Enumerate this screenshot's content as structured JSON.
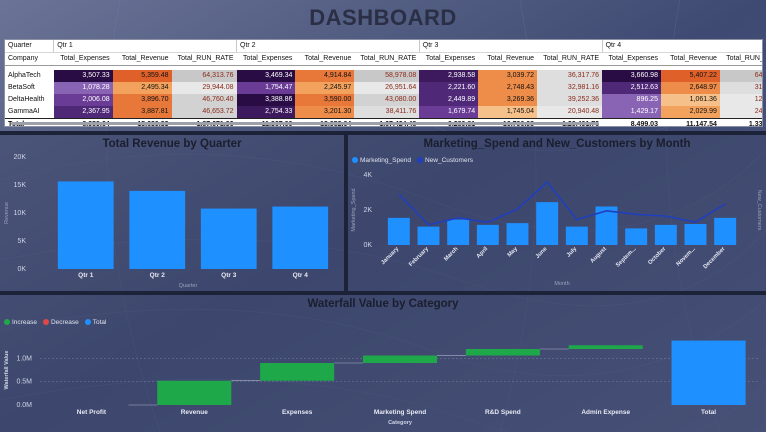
{
  "title": "DASHBOARD",
  "matrix": {
    "row_header_1": "Quarter",
    "row_header_2": "Company",
    "quarters": [
      "Qtr 1",
      "Qtr 2",
      "Qtr 3",
      "Qtr 4"
    ],
    "measures": [
      "Total_Expenses",
      "Total_Revenue",
      "Total_RUN_RATE"
    ],
    "rows": [
      {
        "company": "AlphaTech",
        "values": [
          "3,507.33",
          "5,359.48",
          "64,313.76",
          "3,469.34",
          "4,914.84",
          "58,978.08",
          "2,938.58",
          "3,039.72",
          "36,317.76",
          "3,660.98",
          "5,407.22",
          "64,886.6"
        ]
      },
      {
        "company": "BetaSoft",
        "values": [
          "1,078.28",
          "2,495.34",
          "29,944.08",
          "1,754.47",
          "2,245.97",
          "26,951.64",
          "2,221.60",
          "2,748.43",
          "32,981.16",
          "2,512.63",
          "2,648.97",
          "31,787.6"
        ]
      },
      {
        "company": "DeltaHealth",
        "values": [
          "2,006.08",
          "3,896.70",
          "46,760.40",
          "3,388.86",
          "3,590.00",
          "43,080.00",
          "2,449.89",
          "3,269.36",
          "39,252.36",
          "896.25",
          "1,061.36",
          "12,736.3"
        ]
      },
      {
        "company": "GammaAI",
        "values": [
          "2,367.95",
          "3,887.81",
          "46,653.72",
          "2,754.33",
          "3,201.30",
          "38,411.76",
          "1,679.74",
          "1,745.04",
          "20,940.48",
          "1,429.17",
          "2,029.99",
          "24,359.8"
        ]
      }
    ],
    "total": {
      "label": "Total",
      "values": [
        "8,959.64",
        "15,639.33",
        "1,87,671.96",
        "11,367.00",
        "13,952.04",
        "1,67,424.48",
        "9,289.81",
        "10,790.98",
        "1,29,491.76",
        "8,499.03",
        "11,147.54",
        "1,33,770.4"
      ]
    }
  },
  "revenue_chart": {
    "title": "Total Revenue by Quarter",
    "colors": {
      "bar": "#1e90ff"
    },
    "chart_data": {
      "type": "bar",
      "title": "Total Revenue by Quarter",
      "xlabel": "Quarter",
      "ylabel": "Revenue",
      "categories": [
        "Qtr 1",
        "Qtr 2",
        "Qtr 3",
        "Qtr 4"
      ],
      "values": [
        15639.33,
        13952.04,
        10790.98,
        11147.54
      ],
      "ylim": [
        0,
        20000
      ],
      "yticks": [
        "0K",
        "5K",
        "10K",
        "15K",
        "20K"
      ],
      "grid": false
    }
  },
  "marketing_chart": {
    "title": "Marketing_Spend and New_Customers by Month",
    "legend": [
      "Marketing_Spend",
      "New_Customers"
    ],
    "colors": {
      "bar": "#1e90ff",
      "line": "#1f3fbf"
    },
    "chart_data": {
      "type": "bar",
      "title": "Marketing_Spend and New_Customers by Month",
      "xlabel": "Month",
      "ylabel": "Marketing_Spend",
      "y2label": "New_Customers",
      "categories": [
        "January",
        "February",
        "March",
        "April",
        "May",
        "June",
        "July",
        "August",
        "Septem...",
        "October",
        "Novem...",
        "December"
      ],
      "series": [
        {
          "name": "Marketing_Spend",
          "type": "bar",
          "values": [
            1550,
            1050,
            1450,
            1150,
            1250,
            2450,
            1050,
            2200,
            950,
            1150,
            1200,
            1550
          ]
        },
        {
          "name": "New_Customers",
          "type": "line",
          "values": [
            2900,
            1150,
            1550,
            1300,
            2050,
            3600,
            1450,
            1950,
            1750,
            1650,
            1300,
            2350
          ]
        }
      ],
      "ylim": [
        0,
        4000
      ],
      "yticks": [
        "0K",
        "2K",
        "4K"
      ],
      "grid": false
    }
  },
  "waterfall_chart": {
    "title": "Waterfall Value by Category",
    "legend": [
      "Increase",
      "Decrease",
      "Total"
    ],
    "colors": {
      "increase": "#1fa84a",
      "decrease": "#e04848",
      "total": "#1e90ff"
    },
    "chart_data": {
      "type": "bar",
      "title": "Waterfall Value by Category",
      "xlabel": "Category",
      "ylabel": "Waterfall Value",
      "categories": [
        "Net Profit",
        "Revenue",
        "Expenses",
        "Marketing Spend",
        "R&D Spend",
        "Admin Expense",
        "Total"
      ],
      "series": [
        {
          "name": "Increase",
          "values": [
            0,
            520000,
            380000,
            160000,
            140000,
            80000,
            null
          ]
        },
        {
          "name": "Total",
          "values": [
            null,
            null,
            null,
            null,
            null,
            null,
            1380000
          ]
        }
      ],
      "ylim": [
        0,
        1500000
      ],
      "yticks": [
        "0.0M",
        "0.5M",
        "1.0M"
      ],
      "grid": true
    }
  }
}
